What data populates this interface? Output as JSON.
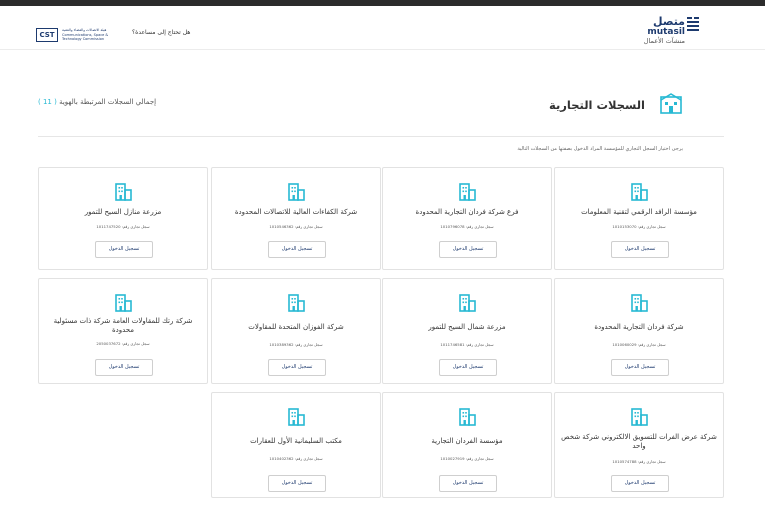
{
  "header": {
    "brand_ar": "متصل",
    "brand_en": "mutasil",
    "brand_sub": "منشآت الأعمال",
    "help_text": "هل تحتاج إلى مساعدة؟",
    "cst_logo": "CST",
    "cst_org_text": "هيئة الاتصالات والفضاء والتقنية Communications, Space & Technology Commission"
  },
  "main": {
    "page_title": "السجلات التجارية",
    "total_label": "إجمالي السجلات المرتبطة بالهوية",
    "total_count": "( 11 )",
    "instruction": "يرجى اختيار السجل التجاري للمؤسسة المراد الدخول بصفتها من السجلات التالية"
  },
  "card_reg_label": "سجل تجاري رقم",
  "card_login_label": "تسجيل الدخول",
  "cards": [
    {
      "name": "مؤسسة الرافد الرقمي لتقنية المعلومات",
      "reg_no": "1010153070"
    },
    {
      "name": "فرع شركة فردان التجارية المحدودة",
      "reg_no": "1010796078"
    },
    {
      "name": "شركة الكفاءات العالية للاتصالات المحدودة",
      "reg_no": "1010546362"
    },
    {
      "name": "مزرعة منازل السيح للتمور",
      "reg_no": "1011747520"
    },
    {
      "name": "شركة فردان التجارية المحدودة",
      "reg_no": "1010060029"
    },
    {
      "name": "مزرعة شمال السيح للتمور",
      "reg_no": "1011746581"
    },
    {
      "name": "شركة الفوزان المتحدة للمقاولات",
      "reg_no": "1010389362"
    },
    {
      "name": "شركة رتك للمقاولات العامة شركة ذات مسئولية محدودة",
      "reg_no": "2050037672"
    },
    {
      "name": "شركة عرض الفرات للتسويق الالكتروني شركة شخص واحد",
      "reg_no": "1010574788"
    },
    {
      "name": "مؤسسة الفردان التجارية",
      "reg_no": "1010027919"
    },
    {
      "name": "مكتب السليمانية الأول للعقارات",
      "reg_no": "1010402362"
    }
  ],
  "colors": {
    "accent": "#27b9d3",
    "brand": "#1d3a6e"
  }
}
